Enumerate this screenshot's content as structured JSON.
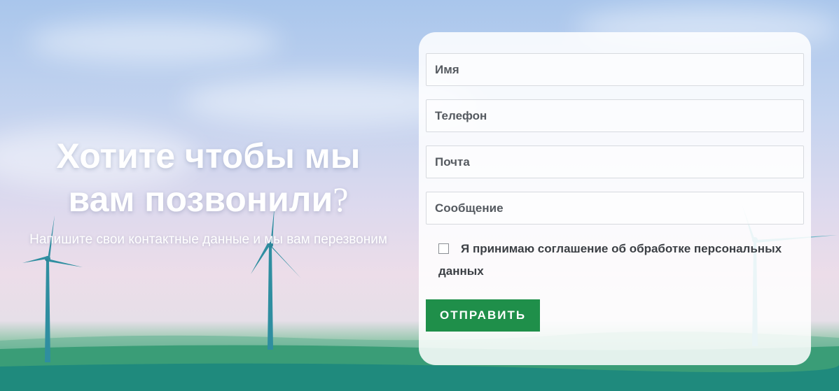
{
  "hero": {
    "headline_line1": "Хотите чтобы мы",
    "headline_line2": "вам позвонили",
    "headline_mark": "?",
    "subtext": "Напишите свои контактные данные и мы вам перезвоним"
  },
  "form": {
    "name_placeholder": "Имя",
    "phone_placeholder": "Телефон",
    "email_placeholder": "Почта",
    "message_placeholder": "Сообщение",
    "consent_label": "Я принимаю соглашение об обработке персональных данных",
    "consent_checked": false,
    "submit_label": "ОТПРАВИТЬ"
  },
  "colors": {
    "submit_bg": "#1f8f4a",
    "card_bg": "#ffffff"
  }
}
